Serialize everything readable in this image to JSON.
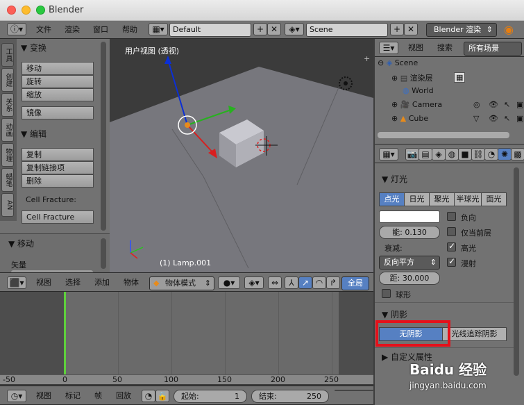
{
  "window": {
    "title": "Blender"
  },
  "topbar": {
    "menus": [
      "文件",
      "渲染",
      "窗口",
      "帮助"
    ],
    "layout": "Default",
    "scene": "Scene",
    "engine": "Blender 渲染"
  },
  "tool_tabs": [
    "工具",
    "创建",
    "关系",
    "动画",
    "物理",
    "蜡笔",
    "AN"
  ],
  "tool_panel": {
    "transform_header": "▼ 变换",
    "transform_buttons": [
      "移动",
      "旋转",
      "缩放"
    ],
    "mirror_button": "镜像",
    "edit_header": "▼ 编辑",
    "edit_buttons": [
      "复制",
      "复制链接项",
      "删除"
    ],
    "cell_fracture_label": "Cell Fracture:",
    "cell_fracture_button": "Cell Fracture",
    "move_header": "▼ 移动",
    "vector_label": "矢量"
  },
  "viewport": {
    "view_label": "用户视图 (透视)",
    "object_label": "(1) Lamp.001"
  },
  "view_header": {
    "menus": [
      "视图",
      "选择",
      "添加",
      "物体"
    ],
    "mode": "物体模式",
    "global": "全局"
  },
  "timeline": {
    "ruler": [
      "-50",
      "0",
      "50",
      "100",
      "150",
      "200",
      "250"
    ],
    "menus": [
      "视图",
      "标记",
      "帧",
      "回放"
    ],
    "start_label": "起始:",
    "start_value": "1",
    "end_label": "结束:",
    "end_value": "250"
  },
  "outliner": {
    "menus": [
      "视图",
      "搜索"
    ],
    "filter": "所有场景",
    "items": [
      "Scene",
      "渲染层",
      "World",
      "Camera",
      "Cube"
    ]
  },
  "properties": {
    "lamp_header": "▼ 灯光",
    "lamp_types": [
      "点光",
      "日光",
      "聚光",
      "半球光",
      "面光"
    ],
    "negative": "负向",
    "this_layer": "仅当前层",
    "energy": "能: 0.130",
    "specular": "高光",
    "falloff_label": "衰减:",
    "falloff_value": "反向平方",
    "diffuse": "漫射",
    "distance": "距: 30.000",
    "sphere": "球形",
    "shadow_header": "▼ 阴影",
    "shadow_options": [
      "无阴影",
      "光线追踪阴影"
    ],
    "custom_props": "▶ 自定义属性"
  },
  "watermark": {
    "brand": "Baidu 经验",
    "url": "jingyan.baidu.com"
  }
}
